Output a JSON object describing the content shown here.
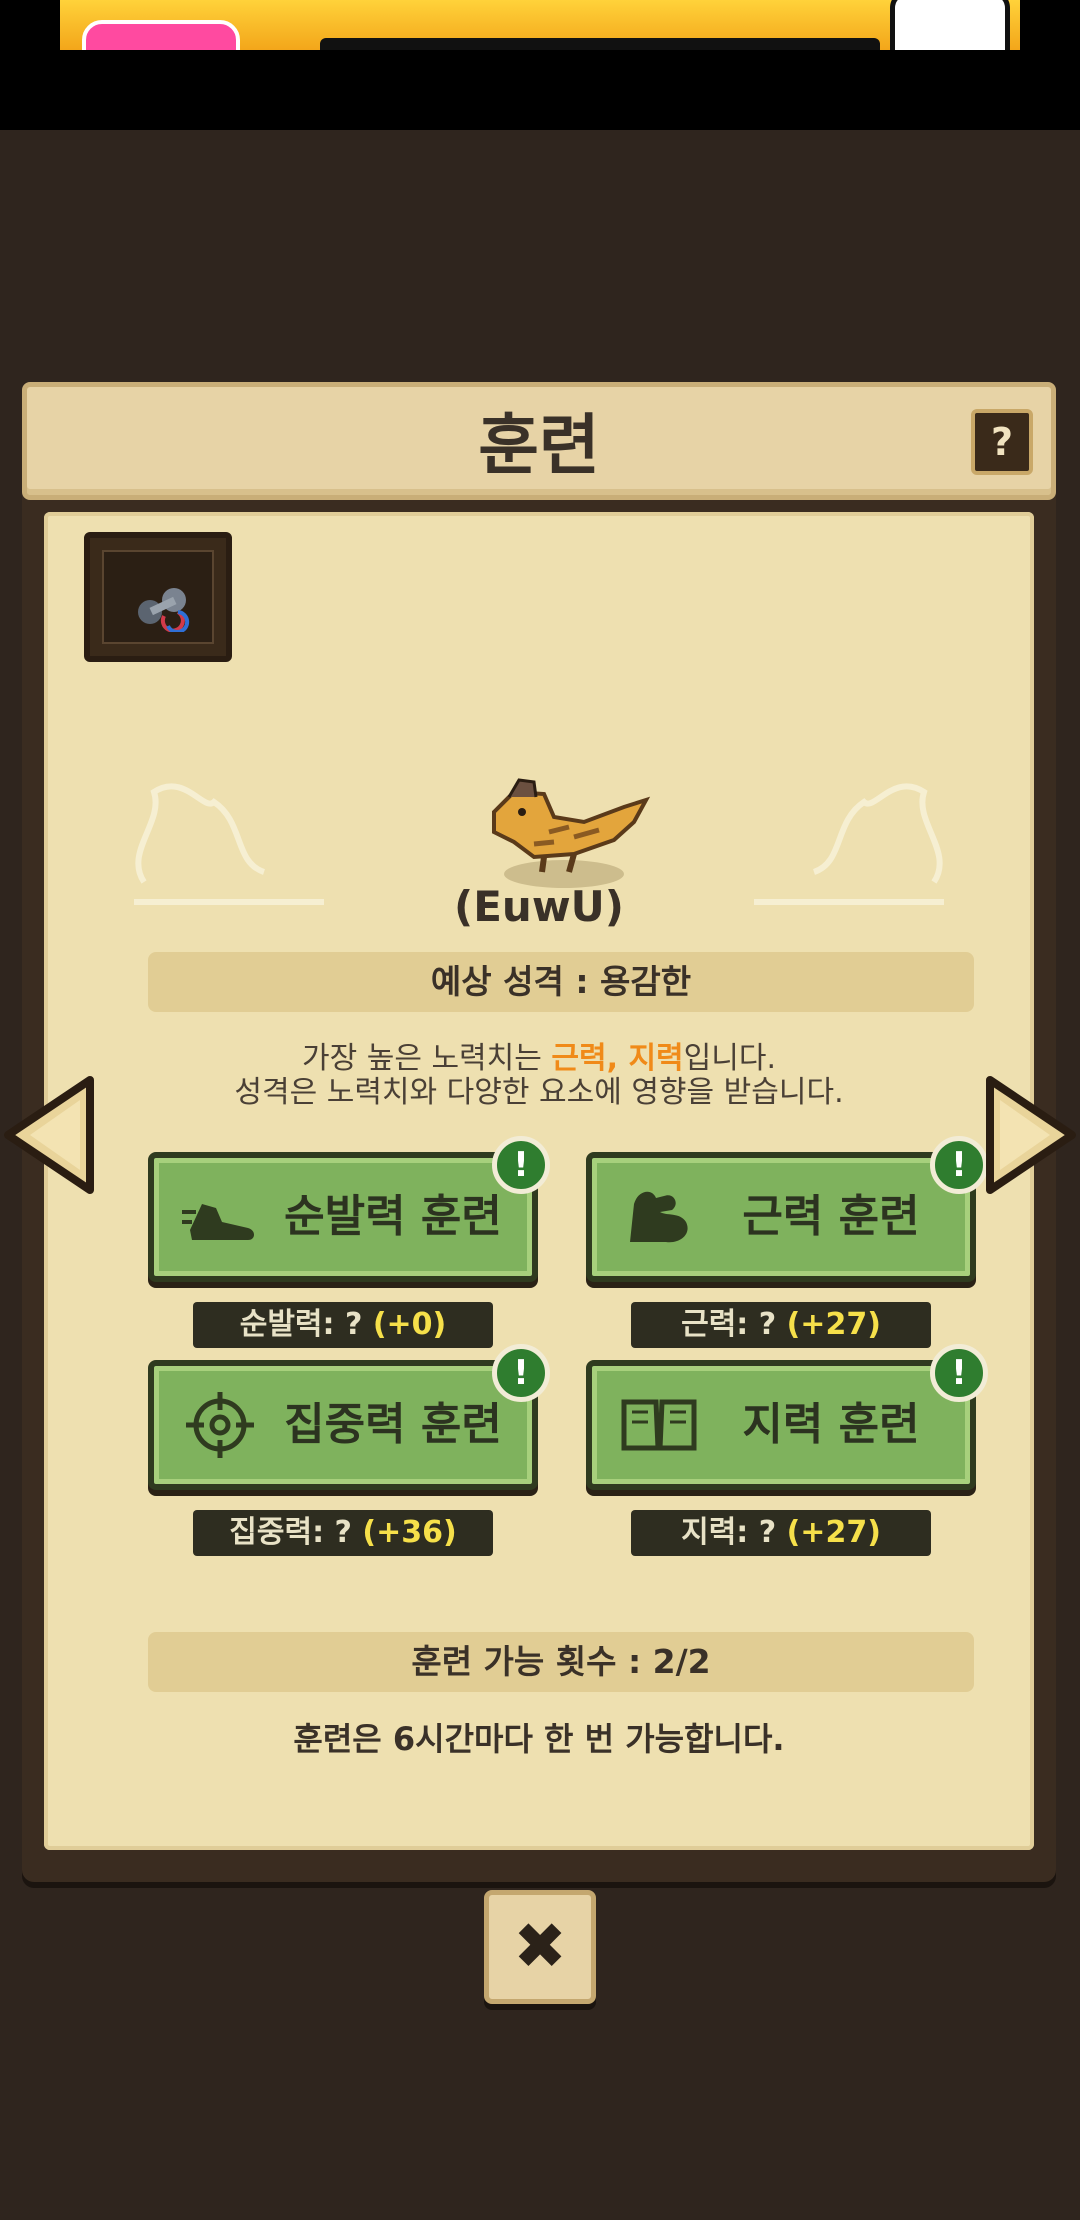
{
  "dialog": {
    "title": "훈련",
    "help_label": "?"
  },
  "pet": {
    "name": "(EuwU)"
  },
  "personality": {
    "label": "예상 성격 : 용감한"
  },
  "description": {
    "line1_prefix": "가장 높은 노력치는 ",
    "line1_highlight": "근력, 지력",
    "line1_suffix": "입니다.",
    "line2": "성격은 노력치와 다양한 요소에 영향을 받습니다."
  },
  "training": [
    {
      "label": "순발력 훈련",
      "icon": "shoe-icon",
      "stat_prefix": "순발력: ? ",
      "stat_value": "(+0)",
      "alert": "!"
    },
    {
      "label": "근력 훈련",
      "icon": "muscle-icon",
      "stat_prefix": "근력: ? ",
      "stat_value": "(+27)",
      "alert": "!"
    },
    {
      "label": "집중력 훈련",
      "icon": "crosshair-icon",
      "stat_prefix": "집중력: ? ",
      "stat_value": "(+36)",
      "alert": "!"
    },
    {
      "label": "지력 훈련",
      "icon": "book-icon",
      "stat_prefix": "지력: ? ",
      "stat_value": "(+27)",
      "alert": "!"
    }
  ],
  "remaining": {
    "label": "훈련 가능 횟수 : 2/2"
  },
  "note": "훈련은 6시간마다 한 번 가능합니다.",
  "close_label": "✖",
  "colors": {
    "accent_orange": "#f08a18",
    "button_green": "#7fb25d",
    "alert_green": "#2f7d2f",
    "stat_yellow": "#f6e04a",
    "panel": "#eee0b0"
  }
}
